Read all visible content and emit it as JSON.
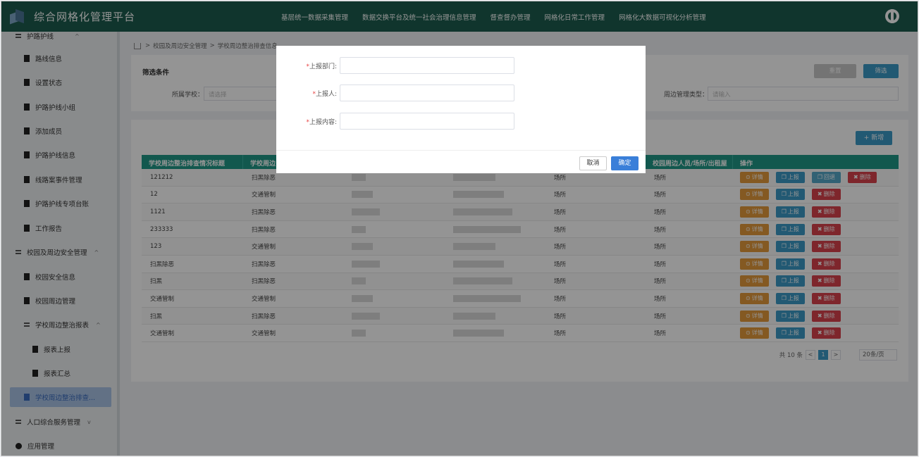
{
  "header": {
    "app_title": "综合网格化管理平台",
    "nav": [
      "基层统一数据采集管理",
      "数据交换平台及统一社会治理信息管理",
      "督查督办管理",
      "网格化日常工作管理",
      "网格化大数据可视化分析管理"
    ]
  },
  "sidebar": {
    "items": [
      {
        "label": "护路护线",
        "kind": "group",
        "arrow": "^"
      },
      {
        "label": "路线信息",
        "kind": "leaf"
      },
      {
        "label": "设置状态",
        "kind": "leaf"
      },
      {
        "label": "护路护线小组",
        "kind": "leaf"
      },
      {
        "label": "添加成员",
        "kind": "leaf"
      },
      {
        "label": "护路护线信息",
        "kind": "leaf"
      },
      {
        "label": "线路案事件管理",
        "kind": "leaf"
      },
      {
        "label": "护路护线专项台账",
        "kind": "leaf"
      },
      {
        "label": "工作报告",
        "kind": "leaf"
      },
      {
        "label": "校园及周边安全管理",
        "kind": "group",
        "arrow": "^"
      },
      {
        "label": "校园安全信息",
        "kind": "leaf"
      },
      {
        "label": "校园周边管理",
        "kind": "leaf"
      },
      {
        "label": "学校周边整治报表",
        "kind": "group",
        "arrow": "^"
      },
      {
        "label": "报表上报",
        "kind": "leaf2"
      },
      {
        "label": "报表汇总",
        "kind": "leaf2"
      },
      {
        "label": "学校周边整治排查...",
        "kind": "active"
      },
      {
        "label": "人口综合服务管理",
        "kind": "group",
        "arrow": "v"
      },
      {
        "label": "应用管理",
        "kind": "gear"
      }
    ]
  },
  "breadcrumb": {
    "items": [
      "校园及周边安全管理",
      "学校周边整治排查信息"
    ],
    "sep": ">"
  },
  "filter": {
    "title": "筛选条件",
    "school_label": "所属学校：",
    "school_placeholder": "请选择",
    "type_label": "周边管理类型：",
    "type_placeholder": "请输入",
    "reset_label": "重置",
    "filter_label": "筛选"
  },
  "toolbar": {
    "add_label": "+ 新增"
  },
  "table": {
    "columns": [
      "学校周边整治排查情况标题",
      "学校周边",
      "",
      "",
      "",
      "校园周边人员/场所/出租屋",
      "操作"
    ],
    "rows": [
      {
        "title": "121212",
        "type": "扫黑除恶",
        "place": "场所",
        "target": "场所",
        "ops": [
          "详情",
          "上报",
          "回退",
          "删除"
        ]
      },
      {
        "title": "12",
        "type": "交通管制",
        "place": "场所",
        "target": "场所",
        "ops": [
          "详情",
          "上报",
          "删除"
        ]
      },
      {
        "title": "1121",
        "type": "扫黑除恶",
        "place": "场所",
        "target": "场所",
        "ops": [
          "详情",
          "上报",
          "删除"
        ]
      },
      {
        "title": "233333",
        "type": "扫黑除恶",
        "place": "场所",
        "target": "场所",
        "ops": [
          "详情",
          "上报",
          "删除"
        ]
      },
      {
        "title": "123",
        "type": "交通管制",
        "place": "场所",
        "target": "场所",
        "ops": [
          "详情",
          "上报",
          "删除"
        ]
      },
      {
        "title": "扫黑除恶",
        "type": "扫黑除恶",
        "place": "场所",
        "target": "场所",
        "ops": [
          "详情",
          "上报",
          "删除"
        ]
      },
      {
        "title": "扫黑",
        "type": "扫黑除恶",
        "place": "场所",
        "target": "场所",
        "ops": [
          "详情",
          "上报",
          "删除"
        ]
      },
      {
        "title": "交通管制",
        "type": "交通管制",
        "place": "场所",
        "target": "场所",
        "ops": [
          "详情",
          "上报",
          "删除"
        ]
      },
      {
        "title": "扫黑",
        "type": "扫黑除恶",
        "place": "场所",
        "target": "场所",
        "ops": [
          "详情",
          "上报",
          "删除"
        ]
      },
      {
        "title": "交通管制",
        "type": "交通管制",
        "place": "场所",
        "target": "场所",
        "ops": [
          "详情",
          "上报",
          "删除"
        ]
      }
    ]
  },
  "pagination": {
    "total": "共 10 条",
    "prev": "<",
    "page": "1",
    "next": ">",
    "page_size": "20条/页"
  },
  "modal": {
    "fields": [
      {
        "label": "上报部门:",
        "value": ""
      },
      {
        "label": "上报人:",
        "value": ""
      },
      {
        "label": "上报内容:",
        "value": ""
      }
    ],
    "required_mark": "*",
    "cancel_label": "取消",
    "ok_label": "确定"
  },
  "colors": {
    "header": "#1c5c4e",
    "table_header": "#1f9887",
    "primary": "#3c9ac7",
    "detail": "#e39a3c",
    "delete": "#d9424c",
    "ok": "#3a7fd9"
  }
}
